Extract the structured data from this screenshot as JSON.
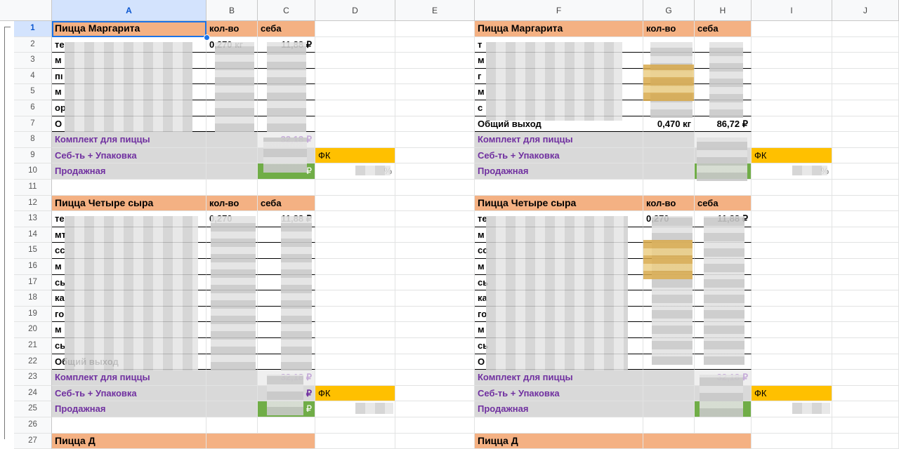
{
  "columns": [
    "A",
    "B",
    "C",
    "D",
    "E",
    "F",
    "G",
    "H",
    "I",
    "J"
  ],
  "rows": [
    "1",
    "2",
    "3",
    "4",
    "5",
    "6",
    "7",
    "8",
    "9",
    "10",
    "11",
    "12",
    "13",
    "14",
    "15",
    "16",
    "17",
    "18",
    "19",
    "20",
    "21",
    "22",
    "23",
    "24",
    "25",
    "26",
    "27"
  ],
  "blocks": [
    {
      "title": "Пицца Маргарита",
      "qty_header": "кол-во",
      "cost_header": "себа",
      "ingredients": [
        "те",
        "м",
        "пı",
        "м",
        "ор",
        "О"
      ],
      "kit_label": "Комплект для пиццы",
      "cost_pack_label": "Себ-ть + Упаковка",
      "fk_label": "ФК",
      "sale_label": "Продажная",
      "qty_partial": "0,270 кг",
      "cost_partial": "11,88 ₽",
      "kit_value": "32,18 ₽",
      "sale_value": "₽",
      "fk_value": "%"
    },
    {
      "title": "Пицца Маргарита",
      "qty_header": "кол-во",
      "cost_header": "себа",
      "ingredients": [
        "т",
        "м",
        "г",
        "м",
        "с",
        "Общий выход"
      ],
      "kit_label": "Комплект для пиццы",
      "cost_pack_label": "Себ-ть + Упаковка",
      "fk_label": "ФК",
      "sale_label": "Продажная",
      "total_qty": "0,470 кг",
      "total_cost": "86,72 ₽",
      "fk_value": "%"
    },
    {
      "title": "Пицца Четыре сыра",
      "qty_header": "кол-во",
      "cost_header": "себа",
      "ingredients": [
        "те",
        "мт",
        "сс",
        "м",
        "сь",
        "ка",
        "го",
        "м",
        "сь",
        "Общий выход"
      ],
      "kit_label": "Комплект для пиццы",
      "cost_pack_label": "Себ-ть + Упаковка",
      "fk_label": "ФК",
      "sale_label": "Продажная",
      "qty_partial": "0,270",
      "cost_partial": "11,88 ₽",
      "kit_value": "32,18 ₽",
      "pack_value": "₽",
      "sale_value": "₽"
    },
    {
      "title": "Пицца Четыре сыра",
      "qty_header": "кол-во",
      "cost_header": "себа",
      "ingredients": [
        "те",
        "м",
        "сс",
        "м",
        "сь",
        "ка",
        "го",
        "м",
        "сь",
        "О"
      ],
      "kit_label": "Комплект для пиццы",
      "cost_pack_label": "Себ-ть + Упаковка",
      "fk_label": "ФК",
      "sale_label": "Продажная",
      "qty_partial": "0,270",
      "cost_partial": "11,88 ₽",
      "kit_value": "32,18 ₽"
    }
  ],
  "next_title_partial": "Пицца Д"
}
